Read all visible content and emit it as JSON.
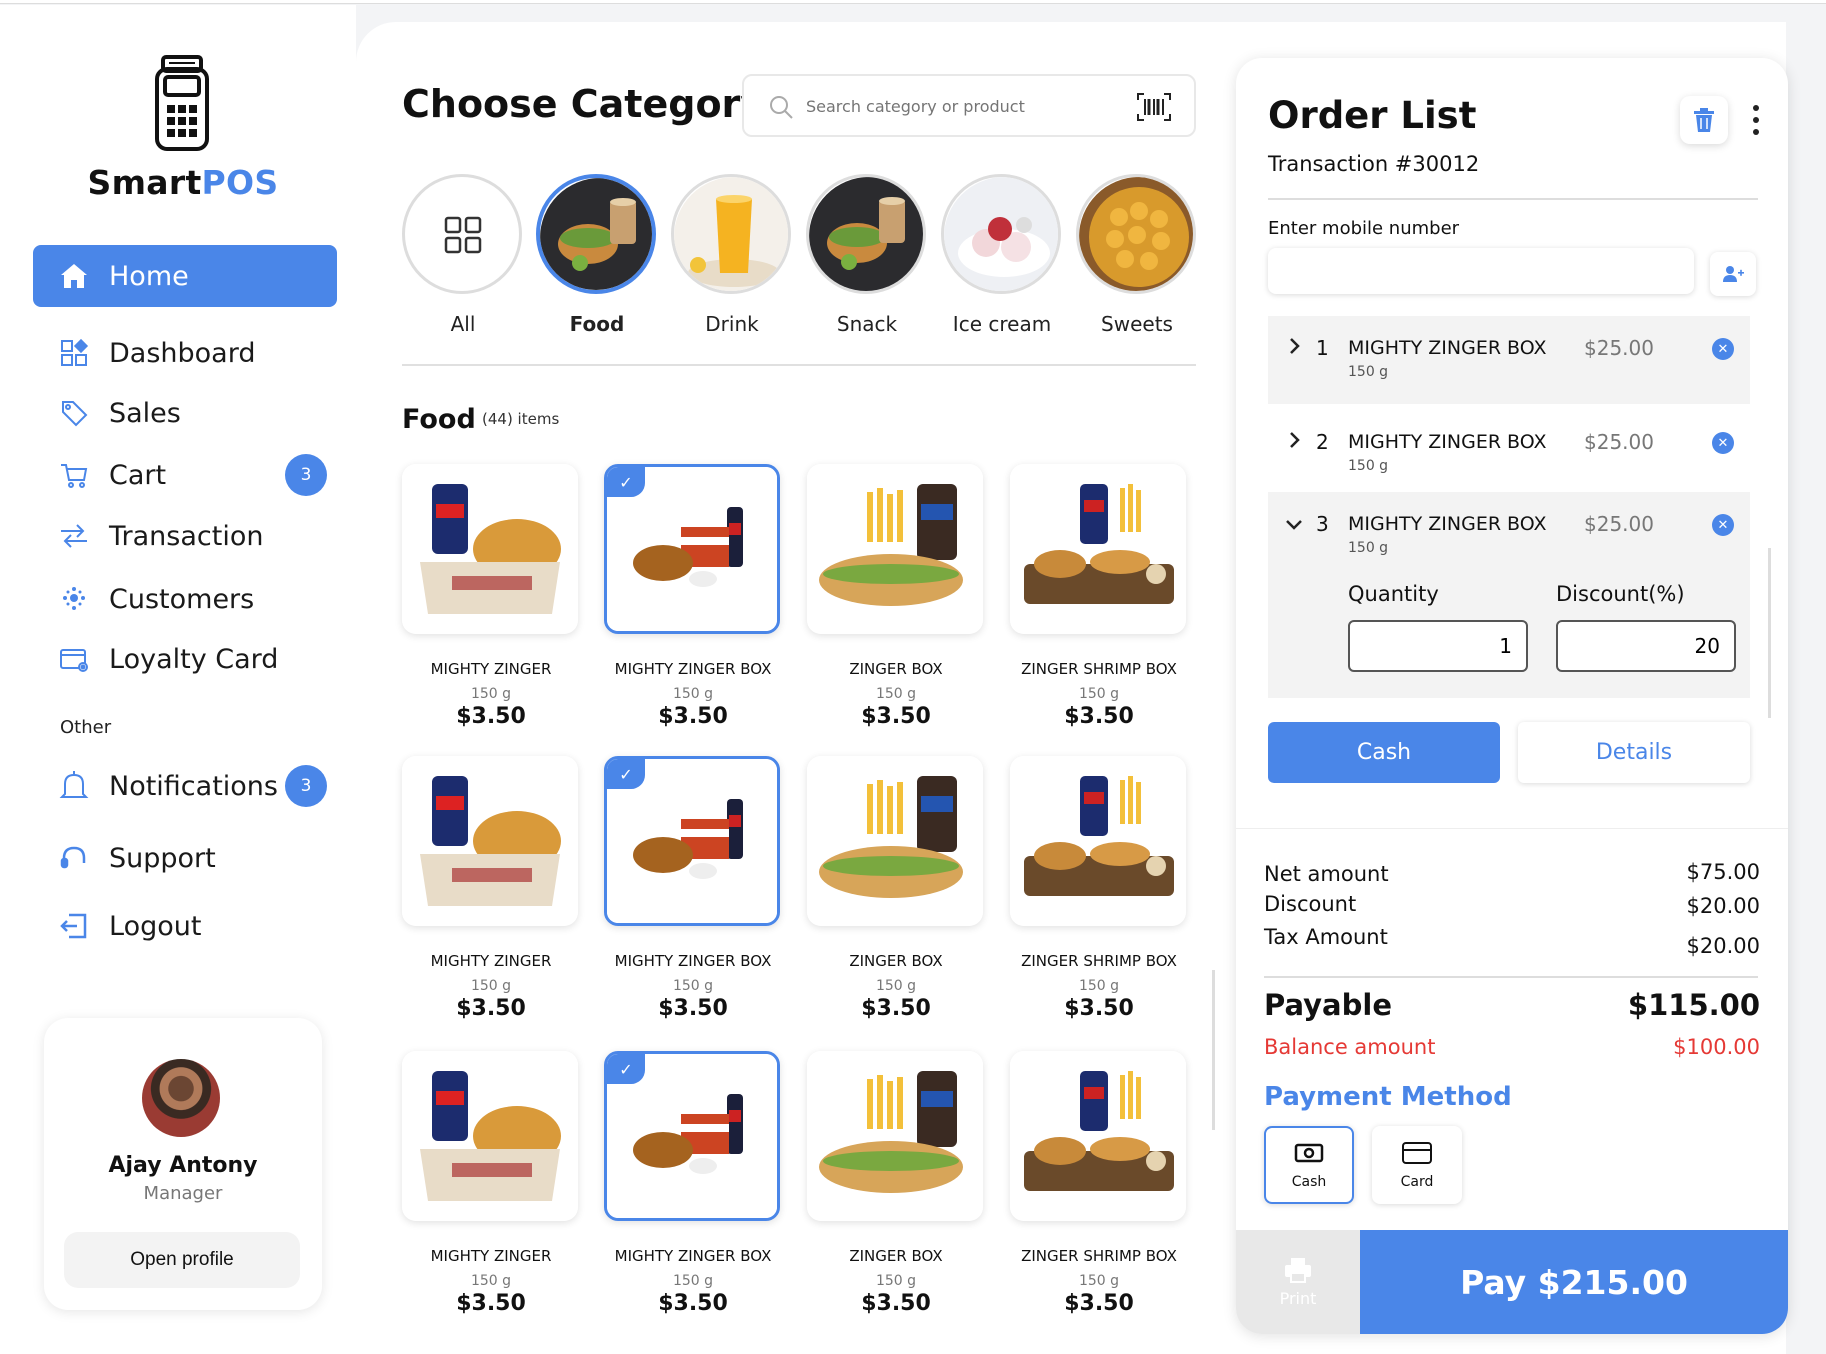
{
  "app": {
    "brand_prefix": "Smart",
    "brand_suffix": "POS"
  },
  "nav": {
    "home": "Home",
    "dashboard": "Dashboard",
    "sales": "Sales",
    "cart": "Cart",
    "cart_badge": "3",
    "transaction": "Transaction",
    "customers": "Customers",
    "loyalty": "Loyalty Card",
    "other_label": "Other",
    "notifications": "Notifications",
    "notifications_badge": "3",
    "support": "Support",
    "logout": "Logout"
  },
  "profile": {
    "name": "Ajay  Antony",
    "role": "Manager",
    "button": "Open profile"
  },
  "main": {
    "title": "Choose Category",
    "search_placeholder": "Search category or product",
    "categories": [
      "All",
      "Food",
      "Drink",
      "Snack",
      "Ice cream",
      "Sweets"
    ],
    "section_title": "Food",
    "section_count": "(44) items",
    "products": [
      {
        "name": "MIGHTY ZINGER",
        "weight": "150 g",
        "price": "$3.50"
      },
      {
        "name": "MIGHTY ZINGER BOX",
        "weight": "150 g",
        "price": "$3.50"
      },
      {
        "name": "ZINGER BOX",
        "weight": "150 g",
        "price": "$3.50"
      },
      {
        "name": "ZINGER SHRIMP BOX",
        "weight": "150 g",
        "price": "$3.50"
      }
    ]
  },
  "order": {
    "title": "Order List",
    "transaction": "Transaction #30012",
    "mobile_label": "Enter mobile number",
    "items": [
      {
        "num": "1",
        "name": "MIGHTY ZINGER BOX",
        "weight": "150 g",
        "price": "$25.00"
      },
      {
        "num": "2",
        "name": "MIGHTY ZINGER BOX",
        "weight": "150 g",
        "price": "$25.00"
      },
      {
        "num": "3",
        "name": "MIGHTY ZINGER BOX",
        "weight": "150 g",
        "price": "$25.00"
      }
    ],
    "quantity_label": "Quantity",
    "discount_label": "Discount(%)",
    "quantity_value": "1",
    "discount_value": "20",
    "cash_button": "Cash",
    "details_button": "Details",
    "net_label": "Net amount",
    "net_value": "$75.00",
    "discount_sum_label": "Discount",
    "discount_sum_value": "$20.00",
    "tax_label": "Tax Amount",
    "tax_value": "$20.00",
    "payable_label": "Payable",
    "payable_value": "$115.00",
    "balance_label": "Balance amount",
    "balance_value": "$100.00",
    "payment_title": "Payment Method",
    "pm_cash": "Cash",
    "pm_card": "Card",
    "print": "Print",
    "pay": "Pay $215.00"
  },
  "colors": {
    "accent": "#4a86e8",
    "danger": "#e53935"
  }
}
